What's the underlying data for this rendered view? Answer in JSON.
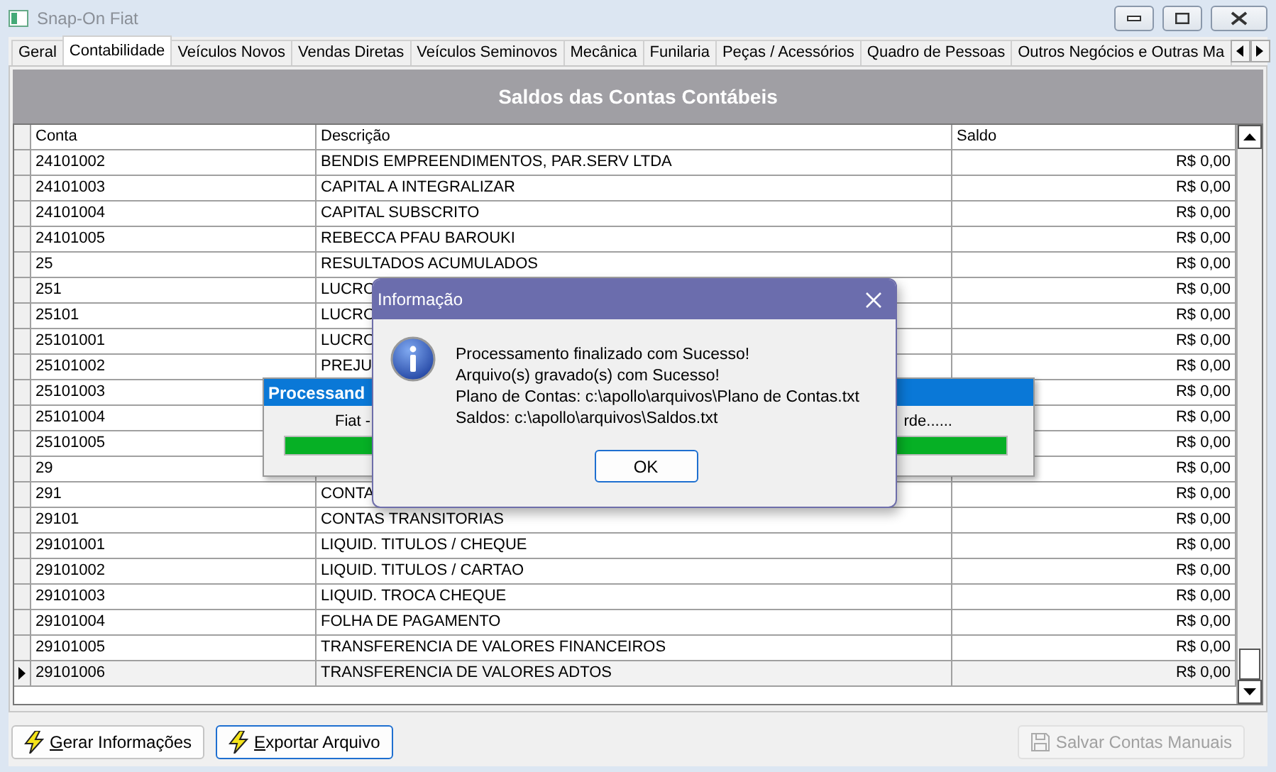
{
  "window": {
    "title": "Snap-On Fiat"
  },
  "tabs": [
    {
      "label": "Geral",
      "selected": false
    },
    {
      "label": "Contabilidade",
      "selected": true
    },
    {
      "label": "Veículos Novos",
      "selected": false
    },
    {
      "label": "Vendas Diretas",
      "selected": false
    },
    {
      "label": "Veículos Seminovos",
      "selected": false
    },
    {
      "label": "Mecânica",
      "selected": false
    },
    {
      "label": "Funilaria",
      "selected": false
    },
    {
      "label": "Peças / Acessórios",
      "selected": false
    },
    {
      "label": "Quadro de Pessoas",
      "selected": false
    },
    {
      "label": "Outros Negócios e Outras Ma",
      "selected": false
    }
  ],
  "panel": {
    "title": "Saldos das Contas Contábeis"
  },
  "table": {
    "columns": [
      "Conta",
      "Descrição",
      "Saldo"
    ],
    "rows": [
      {
        "conta": "24101002",
        "descricao": "BENDIS EMPREENDIMENTOS, PAR.SERV LTDA",
        "saldo": "R$ 0,00",
        "current": false
      },
      {
        "conta": "24101003",
        "descricao": "CAPITAL A INTEGRALIZAR",
        "saldo": "R$ 0,00",
        "current": false
      },
      {
        "conta": "24101004",
        "descricao": "CAPITAL SUBSCRITO",
        "saldo": "R$ 0,00",
        "current": false
      },
      {
        "conta": "24101005",
        "descricao": "REBECCA PFAU BAROUKI",
        "saldo": "R$ 0,00",
        "current": false
      },
      {
        "conta": "25",
        "descricao": "RESULTADOS ACUMULADOS",
        "saldo": "R$ 0,00",
        "current": false
      },
      {
        "conta": "251",
        "descricao": "LUCRO",
        "saldo": "R$ 0,00",
        "current": false
      },
      {
        "conta": "25101",
        "descricao": "LUCRO",
        "saldo": "R$ 0,00",
        "current": false
      },
      {
        "conta": "25101001",
        "descricao": "LUCRO",
        "saldo": "R$ 0,00",
        "current": false
      },
      {
        "conta": "25101002",
        "descricao": "PREJU",
        "saldo": "R$ 0,00",
        "current": false
      },
      {
        "conta": "25101003",
        "saldo": "R$ 0,00",
        "current": false
      },
      {
        "conta": "25101004",
        "saldo": "R$ 0,00",
        "current": false
      },
      {
        "conta": "25101005",
        "saldo": "R$ 0,00",
        "current": false
      },
      {
        "conta": "29",
        "saldo": "R$ 0,00",
        "current": false
      },
      {
        "conta": "291",
        "descricao": "CONTA",
        "saldo": "R$ 0,00",
        "current": false
      },
      {
        "conta": "29101",
        "descricao": "CONTAS TRANSITORIAS",
        "saldo": "R$ 0,00",
        "current": false
      },
      {
        "conta": "29101001",
        "descricao": "LIQUID. TITULOS / CHEQUE",
        "saldo": "R$ 0,00",
        "current": false
      },
      {
        "conta": "29101002",
        "descricao": "LIQUID. TITULOS / CARTAO",
        "saldo": "R$ 0,00",
        "current": false
      },
      {
        "conta": "29101003",
        "descricao": "LIQUID. TROCA CHEQUE",
        "saldo": "R$ 0,00",
        "current": false
      },
      {
        "conta": "29101004",
        "descricao": "FOLHA DE PAGAMENTO",
        "saldo": "R$ 0,00",
        "current": false
      },
      {
        "conta": "29101005",
        "descricao": "TRANSFERENCIA DE VALORES FINANCEIROS",
        "saldo": "R$ 0,00",
        "current": false
      },
      {
        "conta": "29101006",
        "descricao": "TRANSFERENCIA DE VALORES ADTOS",
        "saldo": "R$ 0,00",
        "current": true
      }
    ]
  },
  "buttons": [
    {
      "label": "Gerar Informações",
      "focused": false,
      "disabled": false,
      "kind": "bolt"
    },
    {
      "label": "Exportar Arquivo",
      "focused": true,
      "disabled": false,
      "kind": "bolt"
    },
    {
      "label": "Salvar Contas Manuais",
      "focused": false,
      "disabled": true,
      "kind": "save"
    }
  ],
  "progress": {
    "title": "Processand",
    "text_left": "Fiat -",
    "text_right": "rde......",
    "level": 1
  },
  "dialog": {
    "title": "Informação",
    "lines": [
      "Processamento finalizado com Sucesso!",
      "Arquivo(s) gravado(s) com Sucesso!",
      "Plano de Contas: c:\\apollo\\arquivos\\Plano de Contas.txt",
      "Saldos: c:\\apollo\\arquivos\\Saldos.txt"
    ],
    "button": "OK"
  }
}
